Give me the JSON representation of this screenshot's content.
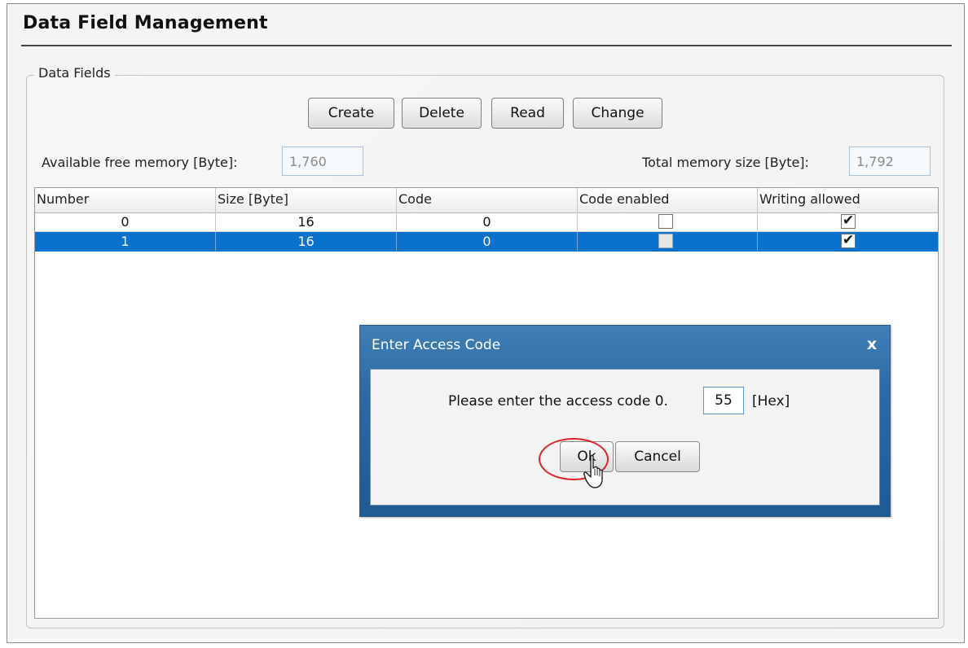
{
  "page": {
    "title": "Data Field Management"
  },
  "group": {
    "legend": "Data Fields"
  },
  "toolbar": {
    "create_label": "Create",
    "delete_label": "Delete",
    "read_label": "Read",
    "change_label": "Change"
  },
  "memory": {
    "free_label": "Available free memory [Byte]:",
    "free_value": "1,760",
    "total_label": "Total memory size [Byte]:",
    "total_value": "1,792"
  },
  "table": {
    "columns": [
      "Number",
      "Size [Byte]",
      "Code",
      "Code enabled",
      "Writing allowed"
    ],
    "rows": [
      {
        "number": "0",
        "size": "16",
        "code": "0",
        "code_enabled": false,
        "writing_allowed": true,
        "selected": false
      },
      {
        "number": "1",
        "size": "16",
        "code": "0",
        "code_enabled": false,
        "writing_allowed": true,
        "selected": true
      }
    ]
  },
  "dialog": {
    "title": "Enter Access Code",
    "close_glyph": "x",
    "prompt": "Please enter the access code 0.",
    "code_value": "55",
    "unit_label": "[Hex]",
    "ok_label": "Ok",
    "cancel_label": "Cancel"
  },
  "icons": {
    "checkmark": "check-icon",
    "close": "close-icon",
    "cursor": "mouse-cursor-icon"
  },
  "colors": {
    "selection": "#0a72cc",
    "dialog_title_bar": "#2d6aa3",
    "highlight": "#e0242b"
  }
}
